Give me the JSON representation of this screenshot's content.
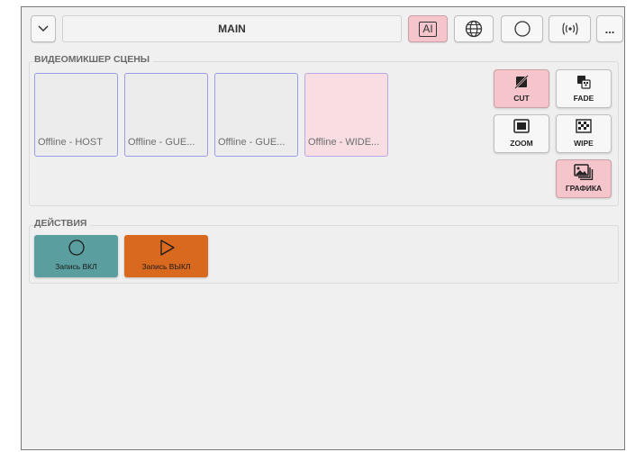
{
  "header": {
    "title": "MAIN",
    "dropdown_icon": "chevron-down-icon",
    "ai_button_label": "AI",
    "globe_icon": "globe-icon",
    "record_icon": "circle-icon",
    "broadcast_icon": "broadcast-icon",
    "more_label": "..."
  },
  "mixer": {
    "section_label": "ВИДЕОМИКШЕР СЦЕНЫ",
    "scenes": [
      {
        "label": "Offline - HOST"
      },
      {
        "label": "Offline - GUE..."
      },
      {
        "label": "Offline - GUE..."
      },
      {
        "label": "Offline - WIDE..."
      }
    ],
    "transitions": {
      "cut": "CUT",
      "fade": "FADE",
      "zoom": "ZOOM",
      "wipe": "WIPE",
      "graphics": "ГРАФИКА"
    }
  },
  "actions": {
    "section_label": "ДЕЙСТВИЯ",
    "items": [
      {
        "label": "Запись ВКЛ",
        "color": "#5b9e9f"
      },
      {
        "label": "Запись ВЫКЛ",
        "color": "#d9691f"
      }
    ]
  },
  "colors": {
    "accent_pink": "#f6c5cc",
    "scene_border": "#9b9be8"
  }
}
